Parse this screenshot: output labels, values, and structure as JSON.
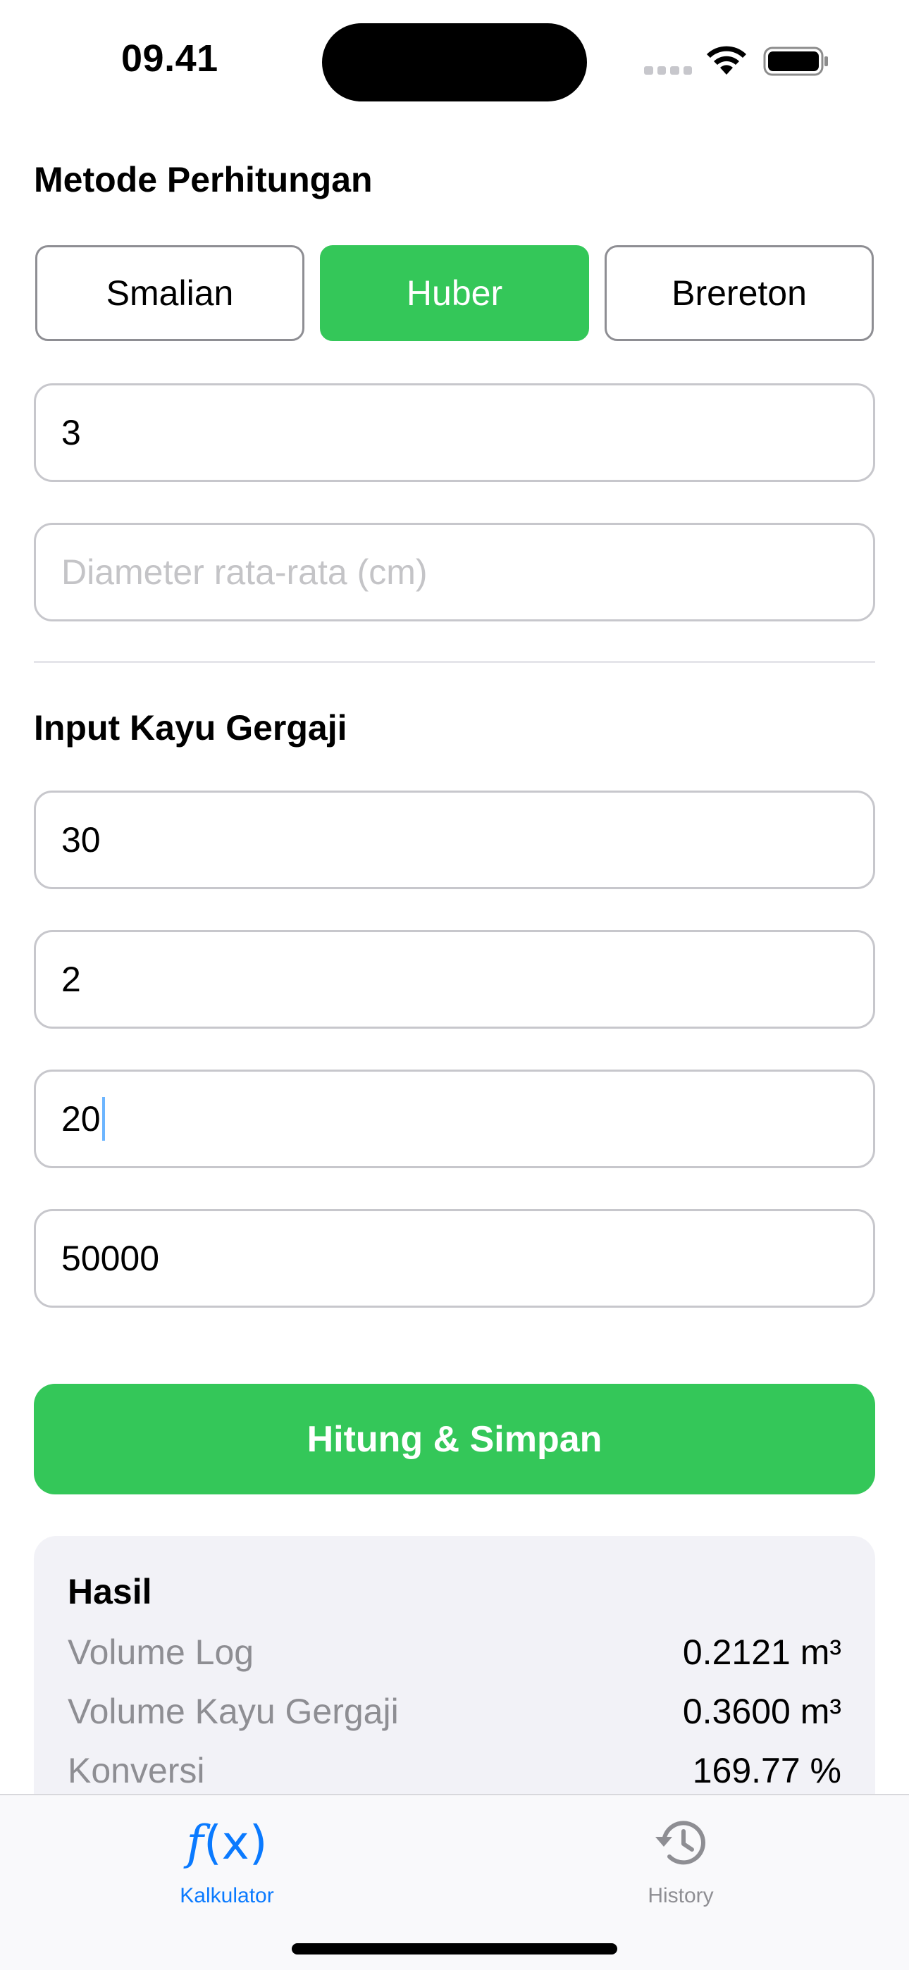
{
  "status_bar": {
    "time": "09.41"
  },
  "calc_method": {
    "title": "Metode Perhitungan",
    "options": [
      "Smalian",
      "Huber",
      "Brereton"
    ],
    "selected": "Huber",
    "length_value": "3",
    "diameter_placeholder": "Diameter rata-rata (cm)"
  },
  "sawn_wood": {
    "title": "Input Kayu Gergaji",
    "fields": [
      "30",
      "2",
      "20",
      "50000"
    ]
  },
  "action": {
    "calc_save_label": "Hitung & Simpan"
  },
  "results": {
    "title": "Hasil",
    "rows": [
      {
        "label": "Volume Log",
        "value": "0.2121 m³"
      },
      {
        "label": "Volume Kayu Gergaji",
        "value": "0.3600 m³"
      },
      {
        "label": "Konversi",
        "value": "169.77 %"
      }
    ]
  },
  "tab_bar": {
    "tabs": [
      {
        "label": "Kalkulator",
        "icon": "function-icon",
        "active": true
      },
      {
        "label": "History",
        "icon": "history-clock-icon",
        "active": false
      }
    ]
  },
  "colors": {
    "accent_green": "#34c759",
    "tab_active_blue": "#0a7aff",
    "secondary_gray": "#8e8e93"
  }
}
